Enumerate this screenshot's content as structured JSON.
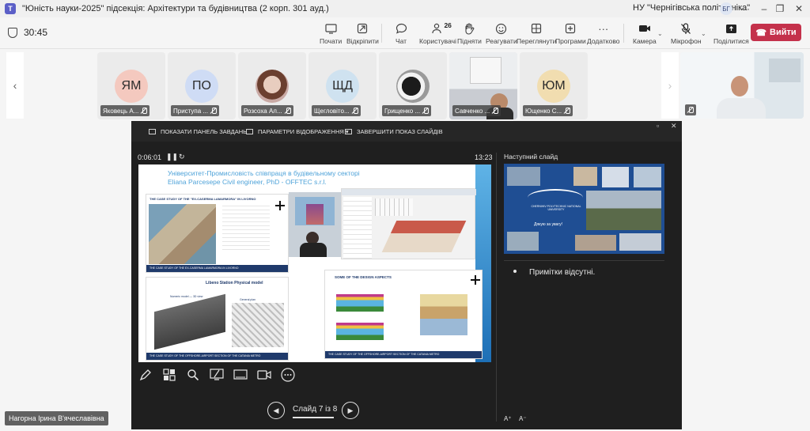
{
  "window": {
    "title": "\"Юність науки-2025\" підсекція: Архітектури та будівництва (2 корп. 301 ауд.)",
    "org": "НУ \"Чернігівська політехніка\"",
    "org_avatar": "БГ",
    "controls": [
      "–",
      "❐",
      "✕"
    ]
  },
  "meeting": {
    "timer": "30:45",
    "toolbar": [
      {
        "label": "Почати",
        "icon": "whiteboard-icon"
      },
      {
        "label": "Відкріпити",
        "icon": "unpin-icon"
      },
      {
        "label": "Чат",
        "icon": "chat-icon"
      },
      {
        "label": "Користувачі",
        "icon": "people-icon",
        "count": "26"
      },
      {
        "label": "Підняти",
        "icon": "raise-hand-icon"
      },
      {
        "label": "Реагувати",
        "icon": "react-icon"
      },
      {
        "label": "Переглянути",
        "icon": "view-icon"
      },
      {
        "label": "Програми",
        "icon": "apps-icon"
      },
      {
        "label": "Додатково",
        "icon": "more-icon"
      },
      {
        "label": "Камера",
        "icon": "camera-icon"
      },
      {
        "label": "Мікрофон",
        "icon": "mic-off-icon"
      },
      {
        "label": "Поділитися",
        "icon": "share-icon"
      }
    ],
    "leave_label": "Вийти"
  },
  "participants": [
    {
      "name": "Яковець А...",
      "initials": "ЯМ",
      "color": "#f4c9bf",
      "photo": false
    },
    {
      "name": "Приступа ...",
      "initials": "ПО",
      "color": "#cfdcf5",
      "photo": false
    },
    {
      "name": "Розсоха Ал...",
      "initials": "",
      "color": "#c9a9a4",
      "photo": true
    },
    {
      "name": "Щегловіто...",
      "initials": "ЩД",
      "color": "#cfe2f0",
      "photo": false
    },
    {
      "name": "Грищенко ...",
      "initials": "",
      "color": "#d8d8d8",
      "photo": true
    },
    {
      "name": "Савченко ...",
      "initials": "",
      "color": "#d9dbe0",
      "photo": true
    },
    {
      "name": "Ющенко С...",
      "initials": "ЮМ",
      "color": "#f1ddb0",
      "photo": false
    }
  ],
  "presentation": {
    "tabs": [
      "ПОКАЗАТИ ПАНЕЛЬ ЗАВДАНЬ",
      "ПАРАМЕТРИ ВІДОБРАЖЕННЯ ▾",
      "ЗАВЕРШИТИ ПОКАЗ СЛАЙДІВ"
    ],
    "elapsed": "0:06:01",
    "clock": "13:23",
    "next_slide_label": "Наступний слайд",
    "notes": "Примітки відсутні.",
    "slide_counter": "Слайд 7 із 8",
    "slide": {
      "title_line1": "Університет-Промисловість співпраця в будівельному секторі",
      "title_line2": "Eliana Parcesepe Civil engineer, PhD - OFFTEC s.r.l.",
      "card1_heading": "THE CASE STUDY OF THE \"EX-CASERMA LAMARMORA\" IN LIVORNO",
      "card3_heading": "Libeno Station Physical model",
      "card3_sub1": "Numeric model — 3D view",
      "card3_sub2": "General plan",
      "card4_heading": "SOME OF THE DESIGN ASPECTS",
      "card1_footer": "THE CASE STUDY OF THE EX-CASERMA LAMARMORA IN LIVORNO",
      "card3_footer": "THE CASE STUDY OF THE OFFSHORE-AIRPORT SECTION OF THE CATANIA METRO",
      "card4_footer": "THE CASE STUDY OF THE OFFSHORE-AIRPORT SECTION OF THE CATANIA METRO"
    },
    "next": {
      "university": "CHERNIHIV POLYTECHNIC NATIONAL UNIVERSITY",
      "thanks": "Дякую за увагу!"
    },
    "font_controls": [
      "A⁺",
      "A⁻"
    ]
  },
  "presenter_name": "Нагорна Ірина В'ячеславівна"
}
